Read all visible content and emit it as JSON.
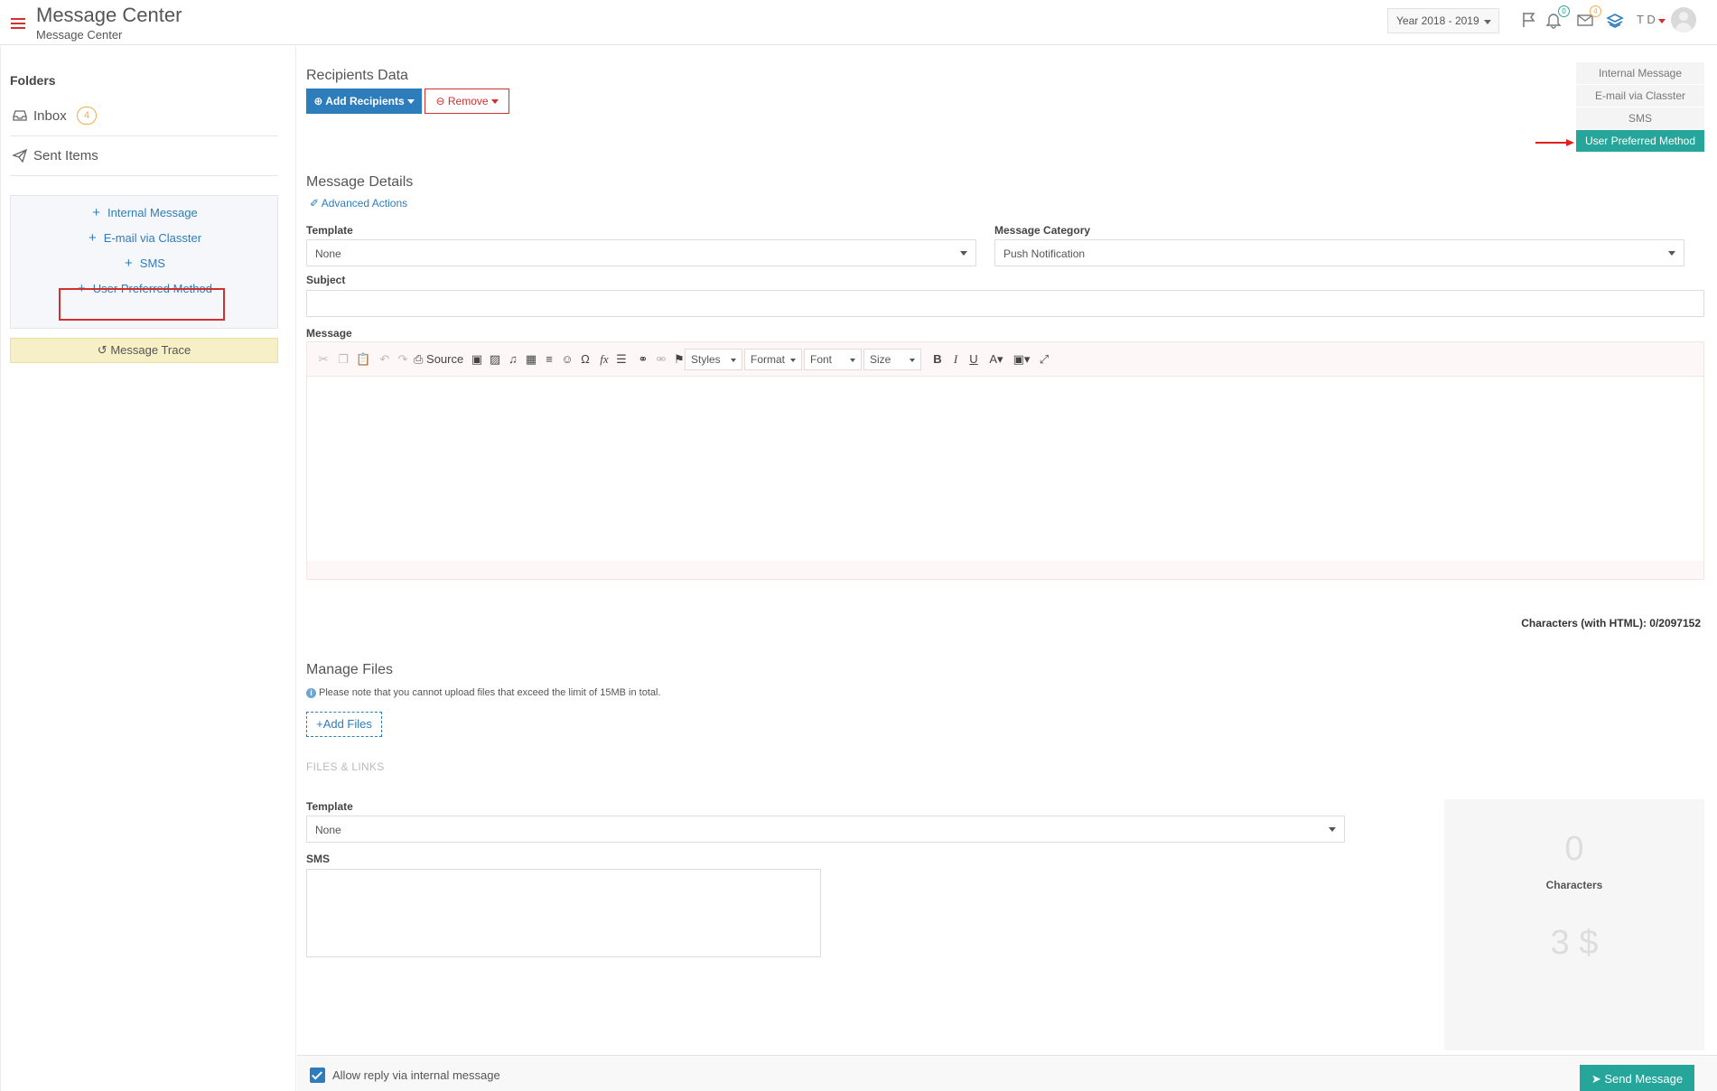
{
  "header": {
    "title": "Message Center",
    "subtitle": "Message Center",
    "year": "Year 2018 - 2019",
    "notif_count": "0",
    "msg_count": "4",
    "user_initials": "T D"
  },
  "sidebar": {
    "folders_title": "Folders",
    "folders": [
      {
        "label": "Inbox",
        "badge": "4"
      },
      {
        "label": "Sent Items"
      }
    ],
    "new_links": [
      {
        "label": "Internal Message"
      },
      {
        "label": "E-mail via Classter"
      },
      {
        "label": "SMS"
      },
      {
        "label": "User Preferred Method"
      }
    ],
    "trace_label": "Message Trace"
  },
  "recipients": {
    "title": "Recipients Data",
    "add_label": "Add Recipients",
    "remove_label": "Remove"
  },
  "methods": {
    "items": [
      {
        "label": "Internal Message",
        "active": false
      },
      {
        "label": "E-mail via Classter",
        "active": false
      },
      {
        "label": "SMS",
        "active": false
      },
      {
        "label": "User Preferred Method",
        "active": true
      }
    ]
  },
  "details": {
    "title": "Message Details",
    "advanced_label": "Advanced Actions",
    "template_label": "Template",
    "template_value": "None",
    "category_label": "Message Category",
    "category_value": "Push Notification",
    "subject_label": "Subject",
    "subject_value": "",
    "message_label": "Message"
  },
  "editor": {
    "source_label": "Source",
    "styles_label": "Styles",
    "format_label": "Format",
    "font_label": "Font",
    "size_label": "Size",
    "char_count": "Characters (with HTML): 0/2097152"
  },
  "files": {
    "title": "Manage Files",
    "note": "Please note that you cannot upload files that exceed the limit of 15MB in total.",
    "add_label": "Add Files",
    "links_label": "FILES & LINKS"
  },
  "sms": {
    "template_label": "Template",
    "template_value": "None",
    "sms_label": "SMS",
    "sms_value": "",
    "char_number": "0",
    "char_label": "Characters",
    "cost": "3 $"
  },
  "footer": {
    "allow_reply_label": "Allow reply via internal message",
    "allow_reply_checked": true,
    "send_label": "Send Message"
  },
  "colors": {
    "primary": "#2d7dbc",
    "accent": "#26a69a",
    "danger": "#d0312d",
    "warning": "#f0ad4e",
    "trace_bg": "#f7f0c6"
  }
}
